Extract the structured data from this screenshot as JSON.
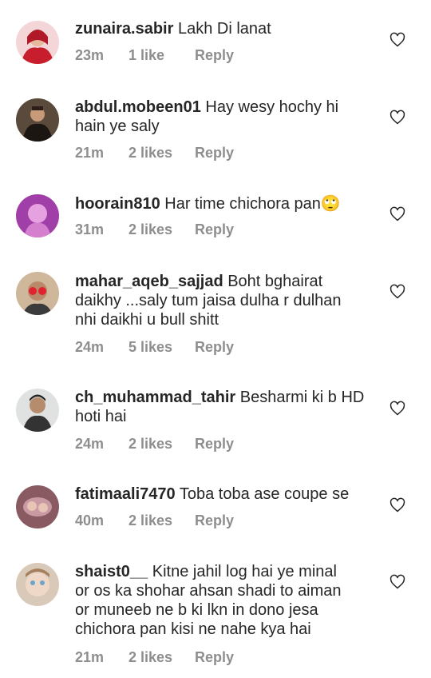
{
  "comments": [
    {
      "username": "zunaira.sabir",
      "text": "Lakh Di lanat",
      "time": "23m",
      "likes": "1 like",
      "reply": "Reply",
      "avatar_colors": [
        "#f4d6d9",
        "#c81d2c"
      ]
    },
    {
      "username": "abdul.mobeen01",
      "text": "Hay wesy hochy hi\nhain ye saly",
      "time": "21m",
      "likes": "2 likes",
      "reply": "Reply",
      "avatar_colors": [
        "#5a4a3c",
        "#1c1612"
      ]
    },
    {
      "username": "hoorain810",
      "text": "Har time chichora pan🙄",
      "time": "31m",
      "likes": "2 likes",
      "reply": "Reply",
      "avatar_colors": [
        "#a13fa8",
        "#e6a1e0"
      ]
    },
    {
      "username": "mahar_aqeb_sajjad",
      "text": "Boht bghairat\ndaikhy ...saly tum jaisa dulha r dulhan\nnhi daikhi u bull shitt",
      "time": "24m",
      "likes": "5 likes",
      "reply": "Reply",
      "avatar_colors": [
        "#cfb79c",
        "#e0232f"
      ]
    },
    {
      "username": "ch_muhammad_tahir",
      "text": "Besharmi ki b HD\nhoti hai",
      "time": "24m",
      "likes": "2 likes",
      "reply": "Reply",
      "avatar_colors": [
        "#dfe2e0",
        "#333333"
      ]
    },
    {
      "username": "fatimaali7470",
      "text": "Toba toba ase coupe se",
      "time": "40m",
      "likes": "2 likes",
      "reply": "Reply",
      "avatar_colors": [
        "#8a5a62",
        "#c99aa3"
      ]
    },
    {
      "username": "shaist0__",
      "text": "Kitne jahil log hai ye minal\nor os ka shohar ahsan shadi to aiman\nor muneeb ne b ki lkn in dono jesa\nchichora pan kisi ne nahe kya hai",
      "time": "21m",
      "likes": "2 likes",
      "reply": "Reply",
      "avatar_colors": [
        "#d9c9b9",
        "#6fa4c9"
      ]
    }
  ]
}
